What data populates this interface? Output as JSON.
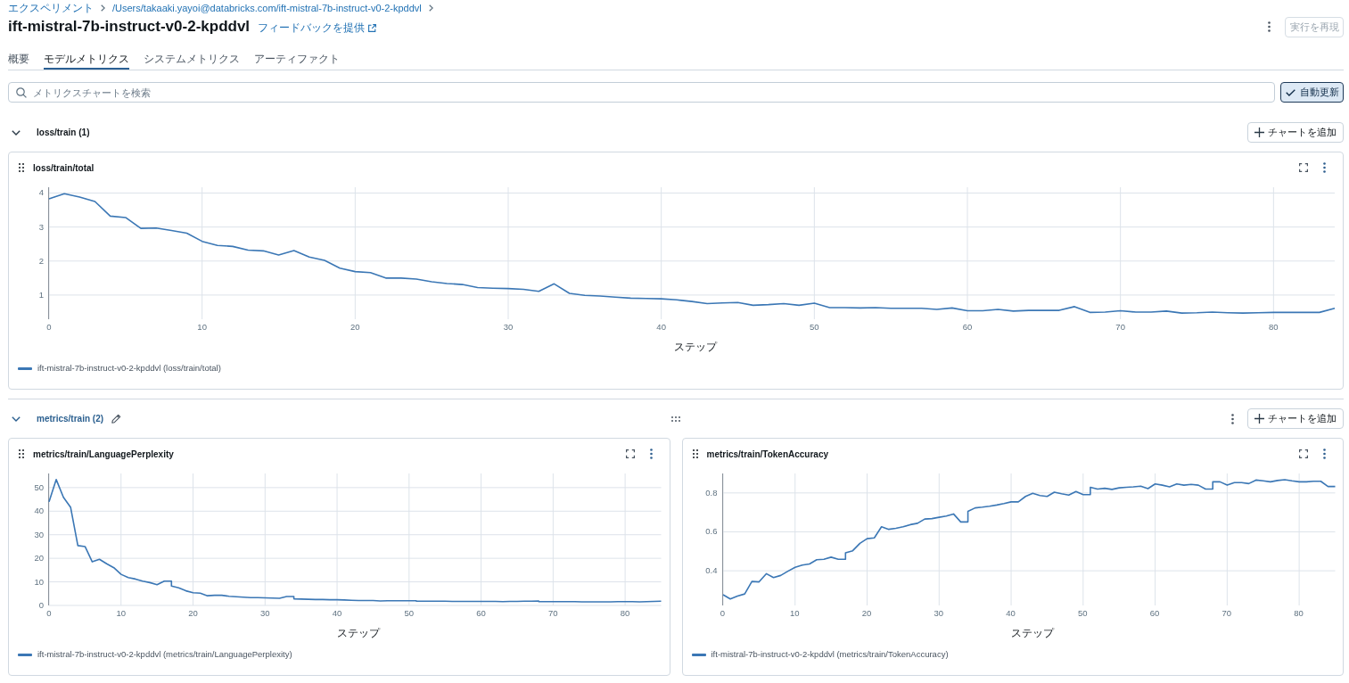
{
  "breadcrumb": [
    {
      "label": "エクスペリメント"
    },
    {
      "label": "/Users/takaaki.yayoi@databricks.com/ift-mistral-7b-instruct-v0-2-kpddvl"
    }
  ],
  "header": {
    "title": "ift-mistral-7b-instruct-v0-2-kpddvl",
    "feedback_link": "フィードバックを提供",
    "reproduce_button": {
      "label": "実行を再現",
      "disabled": true
    }
  },
  "tabs": [
    {
      "label": "概要",
      "selected": false
    },
    {
      "label": "モデルメトリクス",
      "selected": true
    },
    {
      "label": "システムメトリクス",
      "selected": false
    },
    {
      "label": "アーティファクト",
      "selected": false
    }
  ],
  "search": {
    "placeholder": "メトリクスチャートを検索"
  },
  "auto_refresh": {
    "label": "自動更新",
    "checked": true
  },
  "sections": [
    {
      "title": "loss/train (1)",
      "expanded": true,
      "hovered": false,
      "add_chart_label": "チャートを追加",
      "charts": [
        {
          "chart_data": {
            "type": "line",
            "title": "loss/train/total",
            "xlabel": "ステップ",
            "grid": true,
            "x": [
              0,
              1,
              2,
              3,
              4,
              5,
              6,
              7,
              8,
              9,
              10,
              11,
              12,
              13,
              14,
              15,
              16,
              17,
              18,
              19,
              20,
              21,
              22,
              23,
              24,
              25,
              26,
              27,
              28,
              29,
              30,
              31,
              32,
              33,
              34,
              35,
              36,
              37,
              38,
              39,
              40,
              41,
              42,
              43,
              44,
              45,
              46,
              47,
              48,
              49,
              50,
              51,
              52,
              53,
              54,
              55,
              56,
              57,
              58,
              59,
              60,
              61,
              62,
              63,
              64,
              65,
              66,
              67,
              68,
              69,
              70,
              71,
              72,
              73,
              74,
              75,
              76,
              77,
              78,
              79,
              80,
              81,
              82,
              83,
              84
            ],
            "series": [
              {
                "name": "ift-mistral-7b-instruct-v0-2-kpddvl (loss/train/total)",
                "color": "#3b77b5",
                "values": [
                  3.83,
                  3.98,
                  3.88,
                  3.75,
                  3.32,
                  3.28,
                  2.96,
                  2.97,
                  2.9,
                  2.82,
                  2.58,
                  2.46,
                  2.43,
                  2.32,
                  2.3,
                  2.18,
                  2.31,
                  2.12,
                  2.02,
                  1.79,
                  1.69,
                  1.66,
                  1.5,
                  1.5,
                  1.47,
                  1.39,
                  1.34,
                  1.31,
                  1.22,
                  1.2,
                  1.19,
                  1.17,
                  1.11,
                  1.33,
                  1.05,
                  0.99,
                  0.97,
                  0.94,
                  0.91,
                  0.9,
                  0.89,
                  0.86,
                  0.81,
                  0.75,
                  0.77,
                  0.78,
                  0.7,
                  0.72,
                  0.75,
                  0.7,
                  0.76,
                  0.63,
                  0.63,
                  0.62,
                  0.63,
                  0.61,
                  0.61,
                  0.61,
                  0.58,
                  0.62,
                  0.54,
                  0.54,
                  0.58,
                  0.53,
                  0.55,
                  0.55,
                  0.55,
                  0.66,
                  0.49,
                  0.5,
                  0.54,
                  0.5,
                  0.5,
                  0.53,
                  0.47,
                  0.48,
                  0.5,
                  0.48,
                  0.47,
                  0.48,
                  0.49,
                  0.49,
                  0.49,
                  0.49,
                  0.61
                ]
              }
            ],
            "xlim": [
              0,
              84
            ],
            "ylim": [
              0.29,
              4.17
            ],
            "xticks": [
              0,
              10,
              20,
              30,
              40,
              50,
              60,
              70,
              80
            ],
            "yticks": [
              1,
              2,
              3,
              4
            ]
          }
        }
      ]
    },
    {
      "title": "metrics/train (2)",
      "expanded": true,
      "hovered": true,
      "add_chart_label": "チャートを追加",
      "charts": [
        {
          "chart_data": {
            "type": "line",
            "title": "metrics/train/LanguagePerplexity",
            "xlabel": "ステップ",
            "grid": true,
            "x": [
              0,
              1,
              2,
              3,
              4,
              5,
              6,
              7,
              8,
              9,
              10,
              11,
              12,
              13,
              14,
              15,
              16,
              17,
              17,
              18,
              19,
              20,
              21,
              22,
              23,
              24,
              25,
              26,
              27,
              28,
              29,
              30,
              31,
              32,
              33,
              34,
              34,
              35,
              36,
              37,
              38,
              39,
              40,
              41,
              42,
              43,
              44,
              45,
              46,
              47,
              48,
              49,
              50,
              51,
              51,
              52,
              53,
              54,
              55,
              56,
              57,
              58,
              59,
              60,
              61,
              62,
              63,
              64,
              65,
              66,
              67,
              68,
              68,
              69,
              70,
              71,
              72,
              73,
              74,
              75,
              76,
              77,
              78,
              79,
              80,
              81,
              82,
              83,
              84,
              85
            ],
            "series": [
              {
                "name": "ift-mistral-7b-instruct-v0-2-kpddvl (metrics/train/LanguagePerplexity)",
                "color": "#3b77b5",
                "values": [
                  44.0,
                  53.4,
                  45.9,
                  41.6,
                  25.4,
                  25.0,
                  18.5,
                  19.6,
                  17.7,
                  16.0,
                  13.2,
                  11.8,
                  11.2,
                  10.3,
                  9.7,
                  8.8,
                  10.3,
                  10.3,
                  8.2,
                  7.5,
                  6.2,
                  5.4,
                  5.2,
                  4.1,
                  4.3,
                  4.3,
                  3.9,
                  3.7,
                  3.5,
                  3.3,
                  3.3,
                  3.2,
                  3.1,
                  3.0,
                  3.8,
                  3.8,
                  2.8,
                  2.7,
                  2.6,
                  2.5,
                  2.5,
                  2.4,
                  2.4,
                  2.3,
                  2.2,
                  2.1,
                  2.1,
                  2.1,
                  1.9,
                  2.0,
                  2.0,
                  2.0,
                  2.0,
                  2.0,
                  1.8,
                  1.8,
                  1.8,
                  1.8,
                  1.8,
                  1.7,
                  1.7,
                  1.7,
                  1.7,
                  1.7,
                  1.7,
                  1.7,
                  1.6,
                  1.7,
                  1.7,
                  1.8,
                  1.8,
                  1.9,
                  1.6,
                  1.6,
                  1.6,
                  1.6,
                  1.6,
                  1.6,
                  1.5,
                  1.5,
                  1.5,
                  1.5,
                  1.5,
                  1.6,
                  1.6,
                  1.6,
                  1.5,
                  1.6,
                  1.7,
                  1.8
                ]
              }
            ],
            "xlim": [
              0,
              85
            ],
            "ylim": [
              0,
              56
            ],
            "xticks": [
              0,
              10,
              20,
              30,
              40,
              50,
              60,
              70,
              80
            ],
            "yticks": [
              0,
              10,
              20,
              30,
              40,
              50
            ]
          }
        },
        {
          "chart_data": {
            "type": "line",
            "title": "metrics/train/TokenAccuracy",
            "xlabel": "ステップ",
            "grid": true,
            "x": [
              0,
              1,
              2,
              3,
              4,
              5,
              6,
              7,
              8,
              9,
              10,
              11,
              12,
              13,
              14,
              15,
              16,
              17,
              17,
              18,
              19,
              20,
              21,
              22,
              23,
              24,
              25,
              26,
              27,
              28,
              29,
              30,
              31,
              32,
              33,
              34,
              34,
              35,
              36,
              37,
              38,
              39,
              40,
              41,
              42,
              43,
              44,
              45,
              46,
              47,
              48,
              49,
              50,
              51,
              51,
              52,
              53,
              54,
              55,
              56,
              57,
              58,
              59,
              60,
              61,
              62,
              63,
              64,
              65,
              66,
              67,
              68,
              68,
              69,
              70,
              71,
              72,
              73,
              74,
              75,
              76,
              77,
              78,
              79,
              80,
              81,
              82,
              83,
              84,
              85
            ],
            "series": [
              {
                "name": "ift-mistral-7b-instruct-v0-2-kpddvl (metrics/train/TokenAccuracy)",
                "color": "#3b77b5",
                "values": [
                  0.277,
                  0.255,
                  0.27,
                  0.281,
                  0.345,
                  0.343,
                  0.385,
                  0.365,
                  0.376,
                  0.398,
                  0.418,
                  0.429,
                  0.435,
                  0.457,
                  0.459,
                  0.47,
                  0.459,
                  0.459,
                  0.492,
                  0.503,
                  0.541,
                  0.565,
                  0.569,
                  0.626,
                  0.613,
                  0.618,
                  0.626,
                  0.637,
                  0.644,
                  0.666,
                  0.668,
                  0.675,
                  0.681,
                  0.692,
                  0.651,
                  0.651,
                  0.705,
                  0.723,
                  0.727,
                  0.732,
                  0.738,
                  0.745,
                  0.754,
                  0.754,
                  0.782,
                  0.798,
                  0.787,
                  0.782,
                  0.804,
                  0.796,
                  0.789,
                  0.807,
                  0.791,
                  0.791,
                  0.829,
                  0.82,
                  0.824,
                  0.818,
                  0.826,
                  0.829,
                  0.831,
                  0.835,
                  0.822,
                  0.846,
                  0.84,
                  0.831,
                  0.846,
                  0.84,
                  0.844,
                  0.84,
                  0.82,
                  0.82,
                  0.857,
                  0.857,
                  0.84,
                  0.853,
                  0.853,
                  0.848,
                  0.866,
                  0.862,
                  0.857,
                  0.864,
                  0.868,
                  0.862,
                  0.857,
                  0.857,
                  0.86,
                  0.86,
                  0.833,
                  0.833
                ]
              }
            ],
            "xlim": [
              0,
              85
            ],
            "ylim": [
              0.222,
              0.9
            ],
            "xticks": [
              0,
              10,
              20,
              30,
              40,
              50,
              60,
              70,
              80
            ],
            "yticks": [
              0.4,
              0.6,
              0.8
            ]
          }
        }
      ]
    }
  ]
}
